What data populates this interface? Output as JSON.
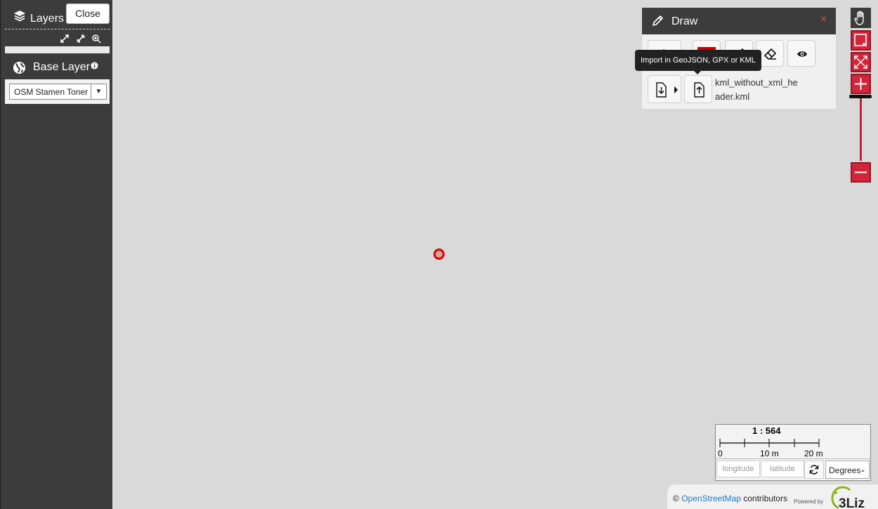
{
  "layers_panel": {
    "title": "Layers",
    "close_label": "Close",
    "base_layer_title": "Base Layer",
    "base_layer_selected": "OSM Stamen Toner",
    "icons": [
      "layers-icon",
      "expand-all-icon",
      "collapse-all-icon",
      "zoom-to-layer-icon",
      "globe-icon",
      "info-icon"
    ]
  },
  "draw_panel": {
    "title": "Draw",
    "close_label": "×",
    "color": "#cf0000",
    "tooltip": "Import in GeoJSON, GPX or KML",
    "import_file_name": "kml_without_xml_header.kml",
    "import_file_name_line1": "kml_without_xml_he",
    "import_file_name_line2": "ader.kml",
    "tools": [
      "draw-pencil-icon",
      "color-picker",
      "edit-icon",
      "erase-icon",
      "visibility-eye-icon",
      "export-icon",
      "import-icon"
    ]
  },
  "navbar": {
    "tools": [
      "pan-hand-icon",
      "zoom-box-icon",
      "zoom-extent-icon",
      "zoom-in-icon",
      "zoom-out-icon"
    ]
  },
  "scale": {
    "ratio": "1 : 564",
    "labels": [
      "0",
      "10 m",
      "20 m"
    ]
  },
  "coordinates": {
    "longitude_placeholder": "longitude",
    "latitude_placeholder": "latitude",
    "unit": "Degrees"
  },
  "attribution": {
    "prefix": "©",
    "link": "OpenStreetMap",
    "suffix": "contributors",
    "powered_by": "Powered by",
    "logo_text": "3Liz"
  },
  "colors": {
    "panel_dark": "#3c3c3c",
    "accent_red": "#d3243a",
    "map_background": "#d9d9d9",
    "marker": "#e00000"
  }
}
